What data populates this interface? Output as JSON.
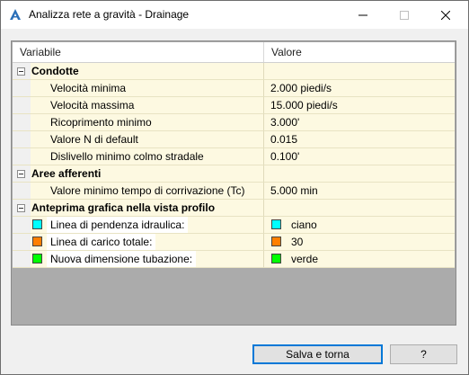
{
  "window": {
    "title": "Analizza rete a gravità - Drainage",
    "controls": [
      "minimize-icon",
      "maximize-icon",
      "close-icon"
    ]
  },
  "grid": {
    "headers": {
      "variable": "Variabile",
      "value": "Valore"
    },
    "groups": [
      {
        "label": "Condotte",
        "rows": [
          {
            "label": "Velocità minima",
            "value": "2.000 piedi/s"
          },
          {
            "label": "Velocità massima",
            "value": "15.000 piedi/s"
          },
          {
            "label": "Ricoprimento minimo",
            "value": "3.000'"
          },
          {
            "label": "Valore N di default",
            "value": "0.015"
          },
          {
            "label": "Dislivello minimo colmo stradale",
            "value": "0.100'"
          }
        ]
      },
      {
        "label": "Aree afferenti",
        "rows": [
          {
            "label": "Valore minimo tempo di corrivazione (Tc)",
            "value": "5.000 min"
          }
        ]
      },
      {
        "label": "Anteprima grafica nella vista profilo",
        "rows": [
          {
            "label": "Linea di pendenza idraulica:",
            "value": "ciano",
            "color": "#00ffff"
          },
          {
            "label": "Linea di carico totale:",
            "value": "30",
            "color": "#ff7f00"
          },
          {
            "label": "Nuova dimensione tubazione:",
            "value": "verde",
            "color": "#00ff00"
          }
        ]
      }
    ]
  },
  "buttons": {
    "save": "Salva e torna",
    "help": "?"
  },
  "colors": {
    "row_bg": "#fdf9e1",
    "accent": "#0078d7"
  }
}
